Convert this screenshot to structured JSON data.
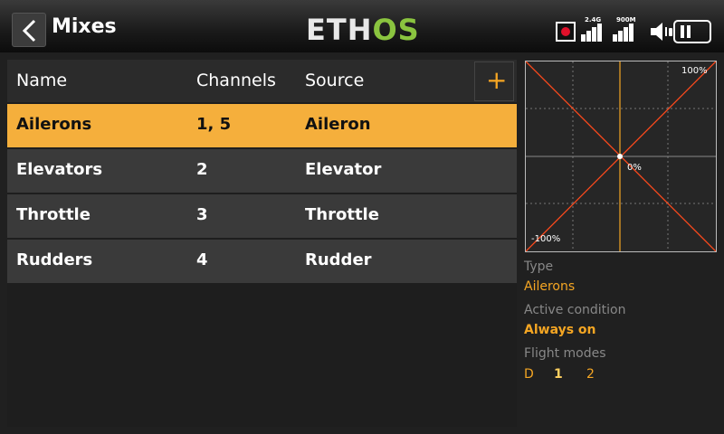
{
  "header": {
    "back_label": "Back",
    "title": "Mixes",
    "logo_main": "ETH",
    "logo_accent": "OS",
    "signal1_label": "2.4G",
    "signal2_label": "900M"
  },
  "table": {
    "columns": [
      "Name",
      "Channels",
      "Source"
    ],
    "add_label": "+",
    "rows": [
      {
        "name": "Ailerons",
        "channels": "1, 5",
        "source": "Aileron"
      },
      {
        "name": "Elevators",
        "channels": "2",
        "source": "Elevator"
      },
      {
        "name": "Throttle",
        "channels": "3",
        "source": "Throttle"
      },
      {
        "name": "Rudders",
        "channels": "4",
        "source": "Rudder"
      }
    ],
    "selected_index": 0
  },
  "graph": {
    "top_right_label": "100%",
    "center_label": "0%",
    "bottom_left_label": "-100%"
  },
  "details": {
    "type_label": "Type",
    "type_value": "Ailerons",
    "condition_label": "Active condition",
    "condition_value": "Always on",
    "flight_modes_label": "Flight modes",
    "flight_modes": [
      "D",
      "1",
      "2"
    ]
  },
  "colors": {
    "accent": "#f5a623",
    "selected_row": "#f5af3c",
    "logo_green": "#8ac43f",
    "record_red": "#e0102a"
  }
}
